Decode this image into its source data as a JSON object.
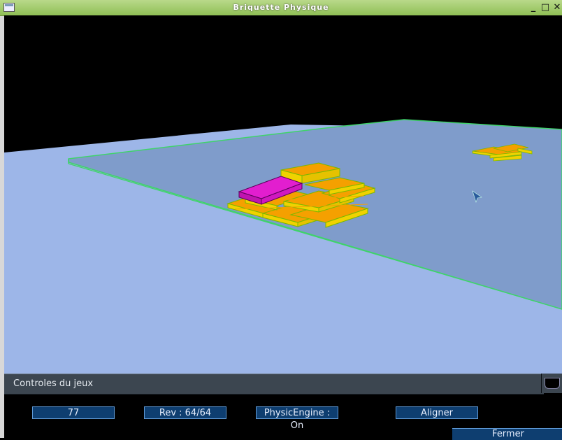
{
  "window": {
    "title": "Briquette Physique"
  },
  "panel": {
    "header": "Controles du jeux",
    "buttons": [
      {
        "label": "77"
      },
      {
        "label": "Rev : 64/64"
      },
      {
        "label": "PhysicEngine : On"
      },
      {
        "label": "Aligner"
      }
    ],
    "close_label": "Fermer"
  },
  "colors": {
    "sky": "#000000",
    "ground": "#9db6e8",
    "plate": "#7f9ccb",
    "plate_edge": "#3fd36a",
    "brick_top": "#f5a000",
    "brick_side": "#f0d200",
    "brick_edge": "#7ab800",
    "selected_brick": "#e21ecf"
  }
}
